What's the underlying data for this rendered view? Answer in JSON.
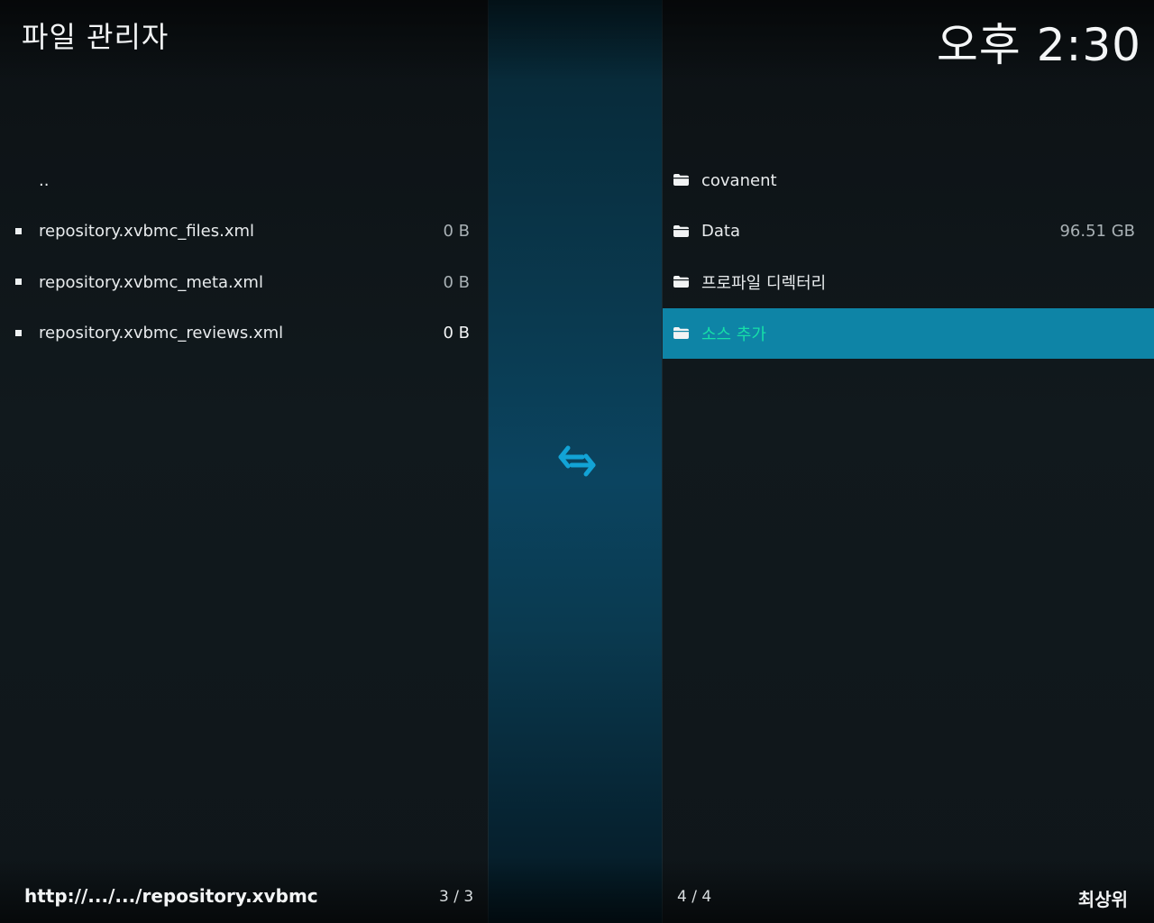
{
  "header": {
    "title": "파일 관리자",
    "clock": "오후 2:30"
  },
  "left_pane": {
    "items": [
      {
        "name": "..",
        "size": "",
        "icon": "none"
      },
      {
        "name": "repository.xvbmc_files.xml",
        "size": "0 B",
        "icon": "file-bullet-icon"
      },
      {
        "name": "repository.xvbmc_meta.xml",
        "size": "0 B",
        "icon": "file-bullet-icon"
      },
      {
        "name": "repository.xvbmc_reviews.xml",
        "size": "0 B",
        "icon": "file-bullet-icon"
      }
    ],
    "path": "http://.../.../repository.xvbmc",
    "count": "3 / 3"
  },
  "right_pane": {
    "items": [
      {
        "name": "covanent",
        "size": "",
        "icon": "folder-icon"
      },
      {
        "name": "Data",
        "size": "96.51 GB",
        "icon": "folder-icon"
      },
      {
        "name": "프로파일 디렉터리",
        "size": "",
        "icon": "folder-icon"
      },
      {
        "name": "소스 추가",
        "size": "",
        "icon": "folder-icon",
        "selected": true
      }
    ],
    "count": "4 / 4",
    "location": "최상위"
  },
  "center": {
    "icon": "swap-arrows-icon"
  },
  "colors": {
    "selection": "#0e84a6",
    "selected_text": "#16e0a8",
    "accent_icon": "#12a3d6",
    "background": "#10181c"
  }
}
